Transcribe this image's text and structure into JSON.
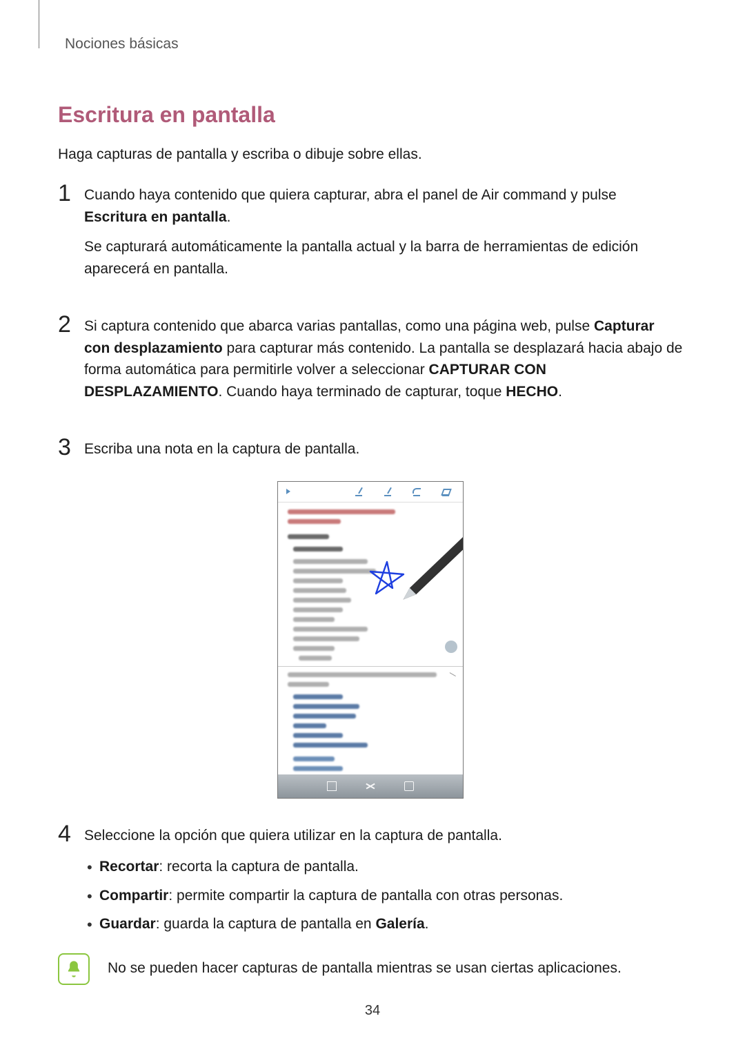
{
  "breadcrumb": "Nociones básicas",
  "section_title": "Escritura en pantalla",
  "intro": "Haga capturas de pantalla y escriba o dibuje sobre ellas.",
  "steps": [
    {
      "num": "1",
      "p1_a": "Cuando haya contenido que quiera capturar, abra el panel de Air command y pulse ",
      "p1_b_bold": "Escritura en pantalla",
      "p1_c": ".",
      "p2": "Se capturará automáticamente la pantalla actual y la barra de herramientas de edición aparecerá en pantalla."
    },
    {
      "num": "2",
      "p1_a": "Si captura contenido que abarca varias pantallas, como una página web, pulse ",
      "p1_b_bold": "Capturar con desplazamiento",
      "p1_c": " para capturar más contenido. La pantalla se desplazará hacia abajo de forma automática para permitirle volver a seleccionar ",
      "p1_d_bold": "CAPTURAR CON DESPLAZAMIENTO",
      "p1_e": ". Cuando haya terminado de capturar, toque ",
      "p1_f_bold": "HECHO",
      "p1_g": "."
    },
    {
      "num": "3",
      "p1": "Escriba una nota en la captura de pantalla."
    },
    {
      "num": "4",
      "p1": "Seleccione la opción que quiera utilizar en la captura de pantalla.",
      "bullets": [
        {
          "term": "Recortar",
          "rest": ": recorta la captura de pantalla."
        },
        {
          "term": "Compartir",
          "rest": ": permite compartir la captura de pantalla con otras personas."
        },
        {
          "term": "Guardar",
          "rest_a": ": guarda la captura de pantalla en ",
          "rest_b_bold": "Galería",
          "rest_c": "."
        }
      ]
    }
  ],
  "note": "No se pueden hacer capturas de pantalla mientras se usan ciertas aplicaciones.",
  "page_number": "34"
}
